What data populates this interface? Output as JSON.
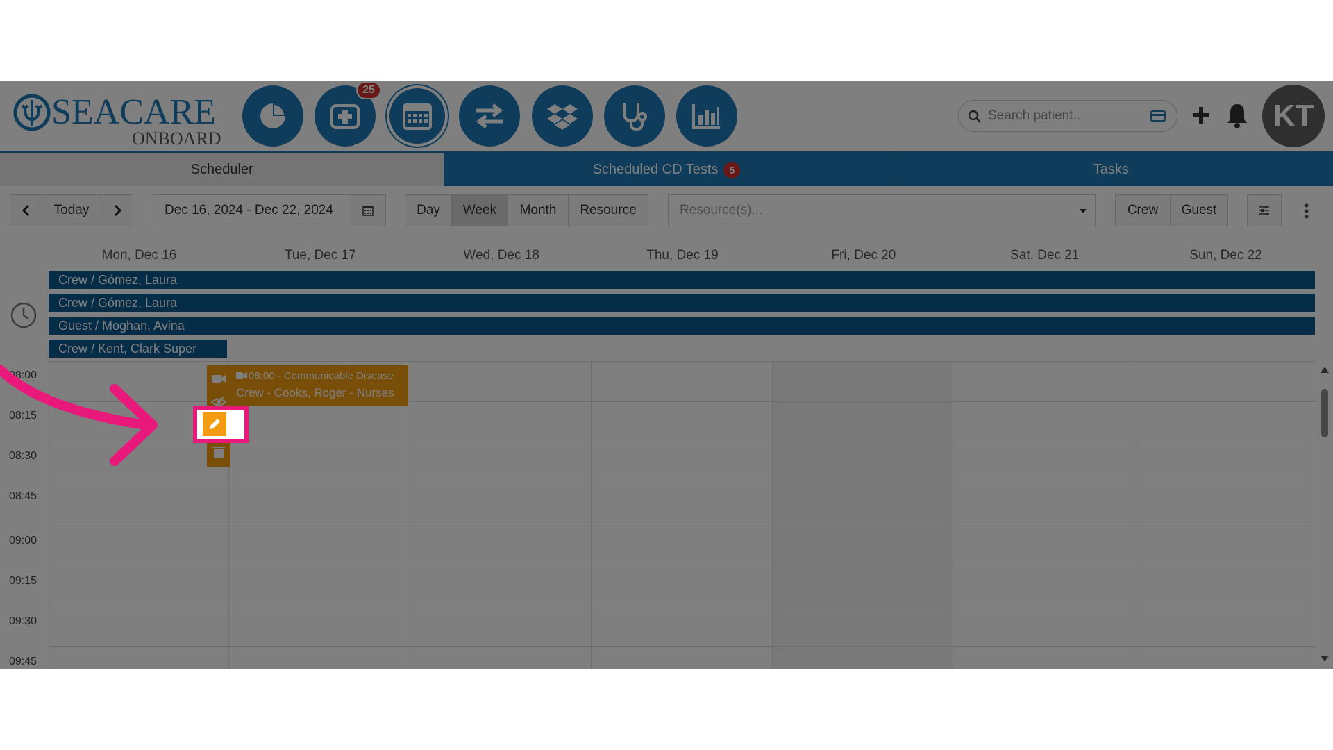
{
  "header": {
    "logo_text": "SEACARE",
    "logo_sub": "ONBOARD",
    "nav_badge": "25",
    "search_placeholder": "Search patient...",
    "avatar_initials": "KT"
  },
  "tabs": [
    {
      "label": "Scheduler",
      "active": true
    },
    {
      "label": "Scheduled CD Tests",
      "badge": "5"
    },
    {
      "label": "Tasks"
    }
  ],
  "toolbar": {
    "today_label": "Today",
    "date_range": "Dec 16, 2024 - Dec 22, 2024",
    "views": [
      "Day",
      "Week",
      "Month",
      "Resource"
    ],
    "active_view": "Week",
    "resource_placeholder": "Resource(s)...",
    "filters": [
      "Crew",
      "Guest"
    ]
  },
  "calendar": {
    "days": [
      "Mon, Dec 16",
      "Tue, Dec 17",
      "Wed, Dec 18",
      "Thu, Dec 19",
      "Fri, Dec 20",
      "Sat, Dec 21",
      "Sun, Dec 22"
    ],
    "all_day_events": [
      "Crew / Gómez, Laura",
      "Crew / Gómez, Laura",
      "Guest / Moghan, Avina",
      "Crew / Kent, Clark Super"
    ],
    "times": [
      "08:00",
      "08:15",
      "08:30",
      "08:45",
      "09:00",
      "09:15",
      "09:30",
      "09:45"
    ],
    "event": {
      "title": "08:00 - Communicable Disease",
      "subtitle": "Crew - Cooks, Roger - Nurses"
    }
  },
  "colors": {
    "brand_blue": "#1f78b4",
    "dark_blue": "#0d5a8f",
    "event_orange": "#f39c12",
    "highlight_pink": "#e8197a",
    "badge_red": "#d32f2f"
  }
}
